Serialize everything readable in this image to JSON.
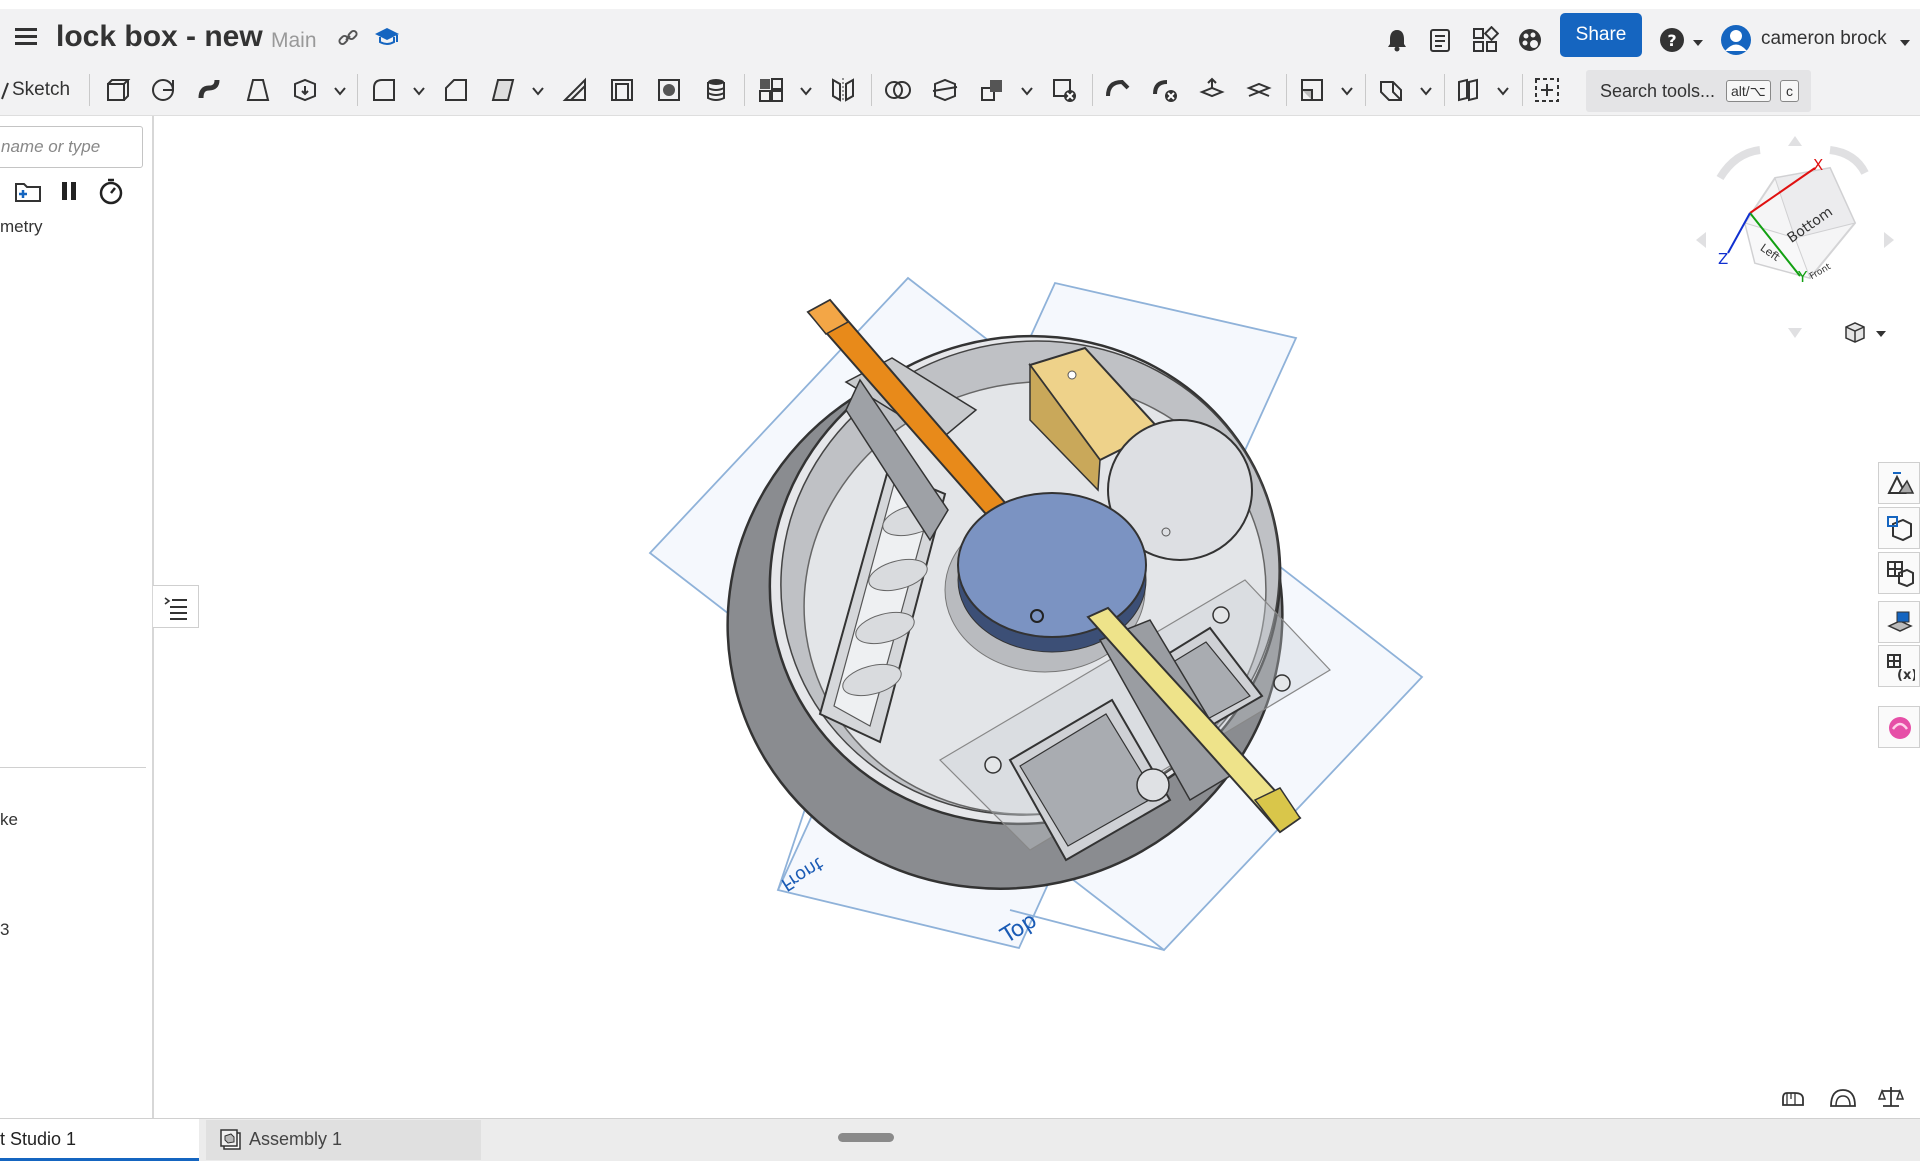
{
  "header": {
    "doc_title": "lock box - new",
    "branch": "Main",
    "share_label": "Share",
    "user_name": "cameron brock",
    "accent": "#1565c0"
  },
  "toolbar": {
    "sketch_label": "Sketch",
    "search_label": "Search tools...",
    "search_key1": "alt/⌥",
    "search_key2": "c"
  },
  "feature_panel": {
    "filter_placeholder": "name or type",
    "section_label": "metry",
    "item_1": "ke",
    "item_2": "3"
  },
  "view_cube": {
    "face_top": "Bottom",
    "face_left": "Left",
    "face_right": "Front",
    "axis_x": "X",
    "axis_y": "Y",
    "axis_z": "Z"
  },
  "viewport": {
    "plane_label_1": "Top",
    "plane_label_2": "Front"
  },
  "tabs": [
    {
      "label": "t Studio 1"
    },
    {
      "label": "Assembly 1"
    }
  ]
}
